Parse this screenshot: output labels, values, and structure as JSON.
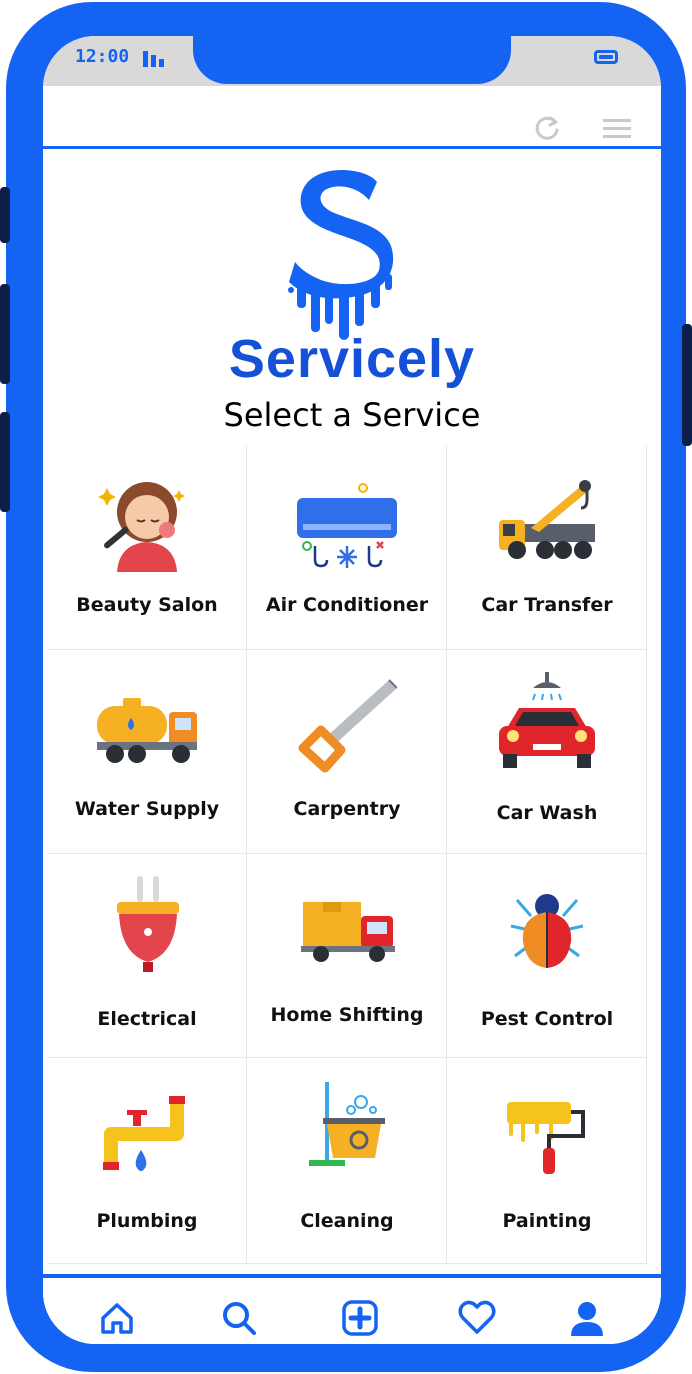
{
  "status_bar": {
    "time": "12:00"
  },
  "brand": {
    "name": "Servicely",
    "subtitle": "Select a Service"
  },
  "services": [
    {
      "label": "Beauty Salon",
      "icon": "beauty-salon-icon"
    },
    {
      "label": "Air Conditioner",
      "icon": "air-conditioner-icon"
    },
    {
      "label": "Car Transfer",
      "icon": "tow-truck-icon"
    },
    {
      "label": "Water Supply",
      "icon": "water-tanker-icon"
    },
    {
      "label": "Carpentry",
      "icon": "hand-saw-icon"
    },
    {
      "label": "Car Wash",
      "icon": "car-wash-icon"
    },
    {
      "label": "Electrical",
      "icon": "electric-plug-icon"
    },
    {
      "label": "Home Shifting",
      "icon": "moving-truck-icon"
    },
    {
      "label": "Pest Control",
      "icon": "bug-icon"
    },
    {
      "label": "Plumbing",
      "icon": "pipe-icon"
    },
    {
      "label": "Cleaning",
      "icon": "mop-bucket-icon"
    },
    {
      "label": "Painting",
      "icon": "paint-roller-icon"
    }
  ],
  "nav": [
    {
      "icon": "home-icon"
    },
    {
      "icon": "search-icon"
    },
    {
      "icon": "add-icon"
    },
    {
      "icon": "heart-icon"
    },
    {
      "icon": "profile-icon"
    }
  ],
  "colors": {
    "accent": "#1463f3",
    "brand_text": "#1451d6"
  }
}
